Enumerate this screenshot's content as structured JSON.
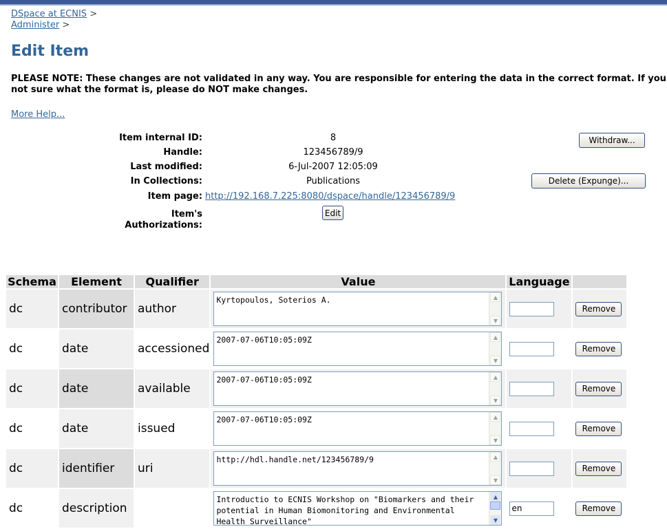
{
  "breadcrumb": [
    {
      "label": "DSpace at ECNIS",
      "sep": ">"
    },
    {
      "label": "Administer",
      "sep": ">"
    }
  ],
  "page_title": "Edit Item",
  "note_text": "PLEASE NOTE: These changes are not validated in any way. You are responsible for entering the data in the correct format. If you are not sure what the format is, please do NOT make changes.",
  "more_help": "More Help...",
  "item_info": {
    "id_label": "Item internal ID:",
    "id_value": "8",
    "handle_label": "Handle:",
    "handle_value": "123456789/9",
    "modified_label": "Last modified:",
    "modified_value": "6-Jul-2007 12:05:09",
    "collections_label": "In Collections:",
    "collections_value": "Publications",
    "page_label": "Item page:",
    "page_value": "http://192.168.7.225:8080/dspace/handle/123456789/9",
    "auth_label_1": "Item's",
    "auth_label_2": "Authorizations:",
    "edit_button": "Edit",
    "withdraw_button": "Withdraw...",
    "delete_button": "Delete (Expunge)..."
  },
  "table": {
    "headers": [
      "Schema",
      "Element",
      "Qualifier",
      "Value",
      "Language",
      ""
    ],
    "remove_label": "Remove",
    "rows": [
      {
        "schema": "dc",
        "element": "contributor",
        "qualifier": "author",
        "value": "Kyrtopoulos, Soterios A.",
        "language": ""
      },
      {
        "schema": "dc",
        "element": "date",
        "qualifier": "accessioned",
        "value": "2007-07-06T10:05:09Z",
        "language": ""
      },
      {
        "schema": "dc",
        "element": "date",
        "qualifier": "available",
        "value": "2007-07-06T10:05:09Z",
        "language": ""
      },
      {
        "schema": "dc",
        "element": "date",
        "qualifier": "issued",
        "value": "2007-07-06T10:05:09Z",
        "language": ""
      },
      {
        "schema": "dc",
        "element": "identifier",
        "qualifier": "uri",
        "value": "http://hdl.handle.net/123456789/9",
        "language": ""
      },
      {
        "schema": "dc",
        "element": "description",
        "qualifier": "",
        "value": "Introductio to ECNIS Workshop on \"Biomarkers and their potential in Human Biomonitoring and Environmental Health Surveillance\"",
        "language": "en"
      }
    ]
  }
}
